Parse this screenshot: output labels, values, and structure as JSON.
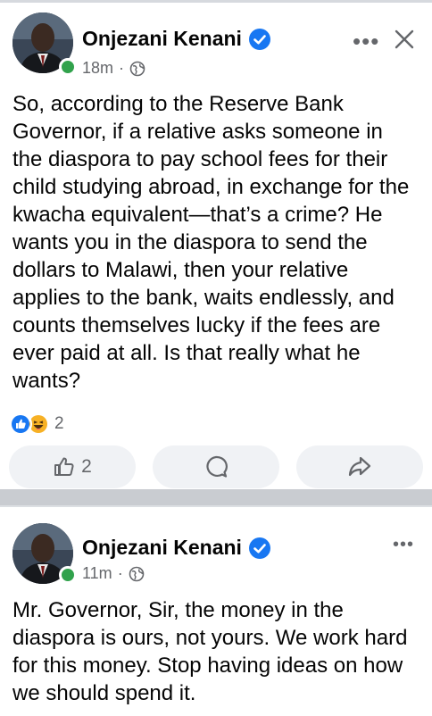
{
  "posts": [
    {
      "author": "Onjezani Kenani",
      "time": "18m",
      "privacy_icon": "globe-icon",
      "text": "So, according to the Reserve Bank Governor, if a relative asks someone in the diaspora to pay school fees for their child studying abroad, in exchange for the kwacha equivalent—that’s a crime? He wants you in the diaspora to send the dollars to Malawi, then your relative applies to the bank, waits endlessly, and counts themselves lucky if the fees are ever paid at all. Is that really what he wants?",
      "reaction_count": "2",
      "like_count": "2"
    },
    {
      "author": "Onjezani Kenani",
      "time": "11m",
      "privacy_icon": "globe-icon",
      "text": "Mr. Governor, Sir, the money in the diaspora is ours, not yours. We work hard for this money. Stop having ideas on how we should spend it."
    }
  ],
  "colors": {
    "verified": "#1877f2",
    "online": "#31a24c",
    "muted": "#65676b",
    "button_bg": "#f0f2f5",
    "separator": "#c9ccd1"
  }
}
